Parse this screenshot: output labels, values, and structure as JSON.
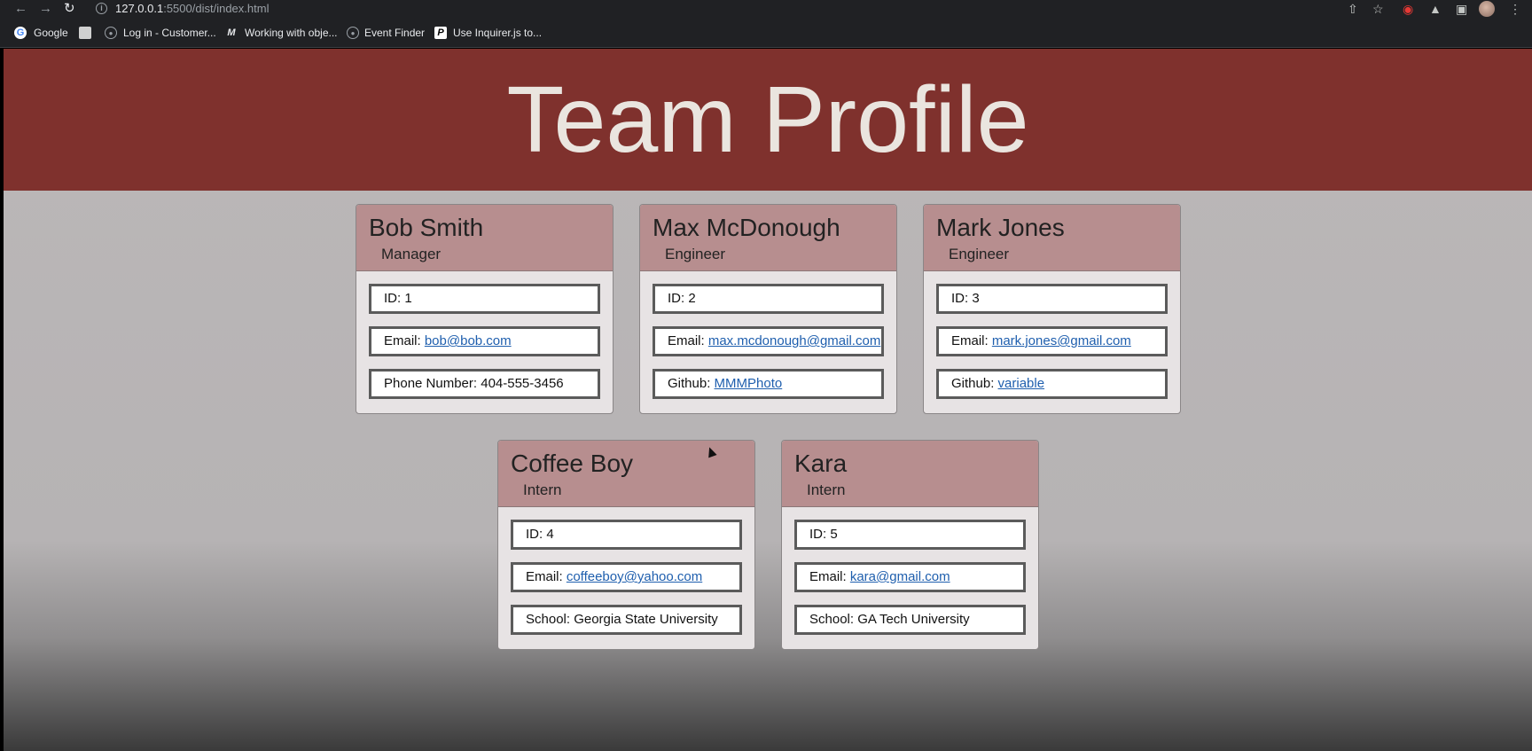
{
  "browser": {
    "url_host": "127.0.0.1",
    "url_path": ":5500/dist/index.html",
    "bookmarks": [
      {
        "label": "Google"
      },
      {
        "label": ""
      },
      {
        "label": "Log in - Customer..."
      },
      {
        "label": "Working with obje..."
      },
      {
        "label": "Event Finder"
      },
      {
        "label": "Use Inquirer.js to..."
      }
    ]
  },
  "page": {
    "title": "Team Profile"
  },
  "team": [
    {
      "name": "Bob Smith",
      "role": "Manager",
      "id": "ID: 1",
      "email_label": "Email: ",
      "email": "bob@bob.com",
      "extra_label": "Phone Number: 404-555-3456",
      "extra_link": ""
    },
    {
      "name": "Max McDonough",
      "role": "Engineer",
      "id": "ID: 2",
      "email_label": "Email: ",
      "email": "max.mcdonough@gmail.com",
      "extra_label": "Github: ",
      "extra_link": "MMMPhoto"
    },
    {
      "name": "Mark Jones",
      "role": "Engineer",
      "id": "ID: 3",
      "email_label": "Email: ",
      "email": "mark.jones@gmail.com",
      "extra_label": "Github: ",
      "extra_link": "variable"
    },
    {
      "name": "Coffee Boy",
      "role": "Intern",
      "id": "ID: 4",
      "email_label": "Email: ",
      "email": "coffeeboy@yahoo.com",
      "extra_label": "School: Georgia State University",
      "extra_link": ""
    },
    {
      "name": "Kara",
      "role": "Intern",
      "id": "ID: 5",
      "email_label": "Email: ",
      "email": "kara@gmail.com",
      "extra_label": "School: GA Tech University",
      "extra_link": ""
    }
  ]
}
